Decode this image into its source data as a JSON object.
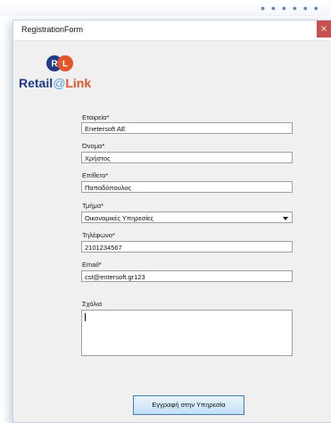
{
  "window": {
    "title": "RegistrationForm",
    "close_glyph": "×"
  },
  "logo": {
    "mark_left": "R",
    "mark_right": "L",
    "word_retail": "Retail",
    "word_at": "@",
    "word_link": "Link"
  },
  "form": {
    "company": {
      "label": "Εταιρεία*",
      "value": "Enetersoft AE"
    },
    "first_name": {
      "label": "Όνομα*",
      "value": "Χρήστος"
    },
    "last_name": {
      "label": "Επίθετο*",
      "value": "Παπαδόπουλος"
    },
    "department": {
      "label": "Τμήμα*",
      "value": "Οικονομικές Υπηρεσίες"
    },
    "phone": {
      "label": "Τηλέφωνο*",
      "value": "2101234567"
    },
    "email": {
      "label": "Email*",
      "value": "cst@entersoft.gr123"
    },
    "comments": {
      "label": "Σχόλια",
      "value": ""
    }
  },
  "submit_label": "Εγγραφή στην Υπηρεσία",
  "colors": {
    "logo_blue": "#1f3c88",
    "logo_orange": "#e4542b",
    "close_red": "#c75050"
  }
}
